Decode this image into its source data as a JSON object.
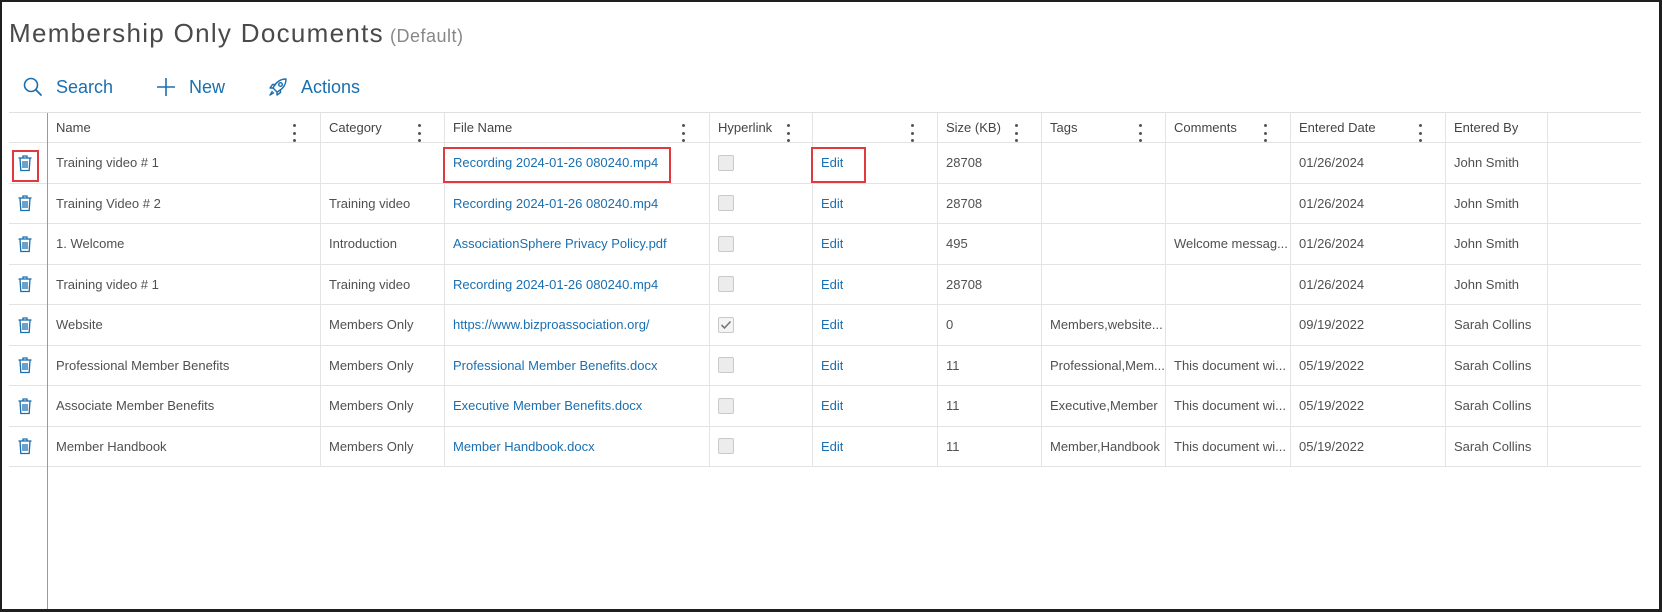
{
  "page": {
    "title": "Membership Only Documents",
    "subtitle": "(Default)"
  },
  "toolbar": {
    "search_label": "Search",
    "new_label": "New",
    "actions_label": "Actions"
  },
  "table": {
    "columns": [
      "Name",
      "Category",
      "File Name",
      "Hyperlink",
      "",
      "Size (KB)",
      "Tags",
      "Comments",
      "Entered Date",
      "Entered By"
    ],
    "rows": [
      {
        "name": "Training video # 1",
        "category": "",
        "file": "Recording 2024-01-26 080240.mp4",
        "hyperlink": false,
        "action": "Edit",
        "size": "28708",
        "tags": "",
        "comments": "",
        "date": "01/26/2024",
        "by": "John Smith"
      },
      {
        "name": "Training Video # 2",
        "category": "Training video",
        "file": "Recording 2024-01-26 080240.mp4",
        "hyperlink": false,
        "action": "Edit",
        "size": "28708",
        "tags": "",
        "comments": "",
        "date": "01/26/2024",
        "by": "John Smith"
      },
      {
        "name": "1. Welcome",
        "category": "Introduction",
        "file": "AssociationSphere Privacy Policy.pdf",
        "hyperlink": false,
        "action": "Edit",
        "size": "495",
        "tags": "",
        "comments": "Welcome messag...",
        "date": "01/26/2024",
        "by": "John Smith"
      },
      {
        "name": "Training video # 1",
        "category": "Training video",
        "file": "Recording 2024-01-26 080240.mp4",
        "hyperlink": false,
        "action": "Edit",
        "size": "28708",
        "tags": "",
        "comments": "",
        "date": "01/26/2024",
        "by": "John Smith"
      },
      {
        "name": "Website",
        "category": "Members Only",
        "file": "https://www.bizproassociation.org/",
        "hyperlink": true,
        "action": "Edit",
        "size": "0",
        "tags": "Members,website...",
        "comments": "",
        "date": "09/19/2022",
        "by": "Sarah Collins"
      },
      {
        "name": "Professional Member Benefits",
        "category": "Members Only",
        "file": "Professional Member Benefits.docx",
        "hyperlink": false,
        "action": "Edit",
        "size": "11",
        "tags": "Professional,Mem...",
        "comments": "This document wi...",
        "date": "05/19/2022",
        "by": "Sarah Collins"
      },
      {
        "name": "Associate Member Benefits",
        "category": "Members Only",
        "file": "Executive Member Benefits.docx",
        "hyperlink": false,
        "action": "Edit",
        "size": "11",
        "tags": "Executive,Member",
        "comments": "This document wi...",
        "date": "05/19/2022",
        "by": "Sarah Collins"
      },
      {
        "name": "Member Handbook",
        "category": "Members Only",
        "file": "Member Handbook.docx",
        "hyperlink": false,
        "action": "Edit",
        "size": "11",
        "tags": "Member,Handbook",
        "comments": "This document wi...",
        "date": "05/19/2022",
        "by": "Sarah Collins"
      }
    ]
  },
  "highlight_color": "#e0393e",
  "link_color": "#1a6fb0",
  "icons": {
    "search": "search-icon",
    "new": "plus-icon",
    "actions": "rocket-icon",
    "delete": "trash-icon",
    "column_menu": "kebab-menu-icon"
  }
}
